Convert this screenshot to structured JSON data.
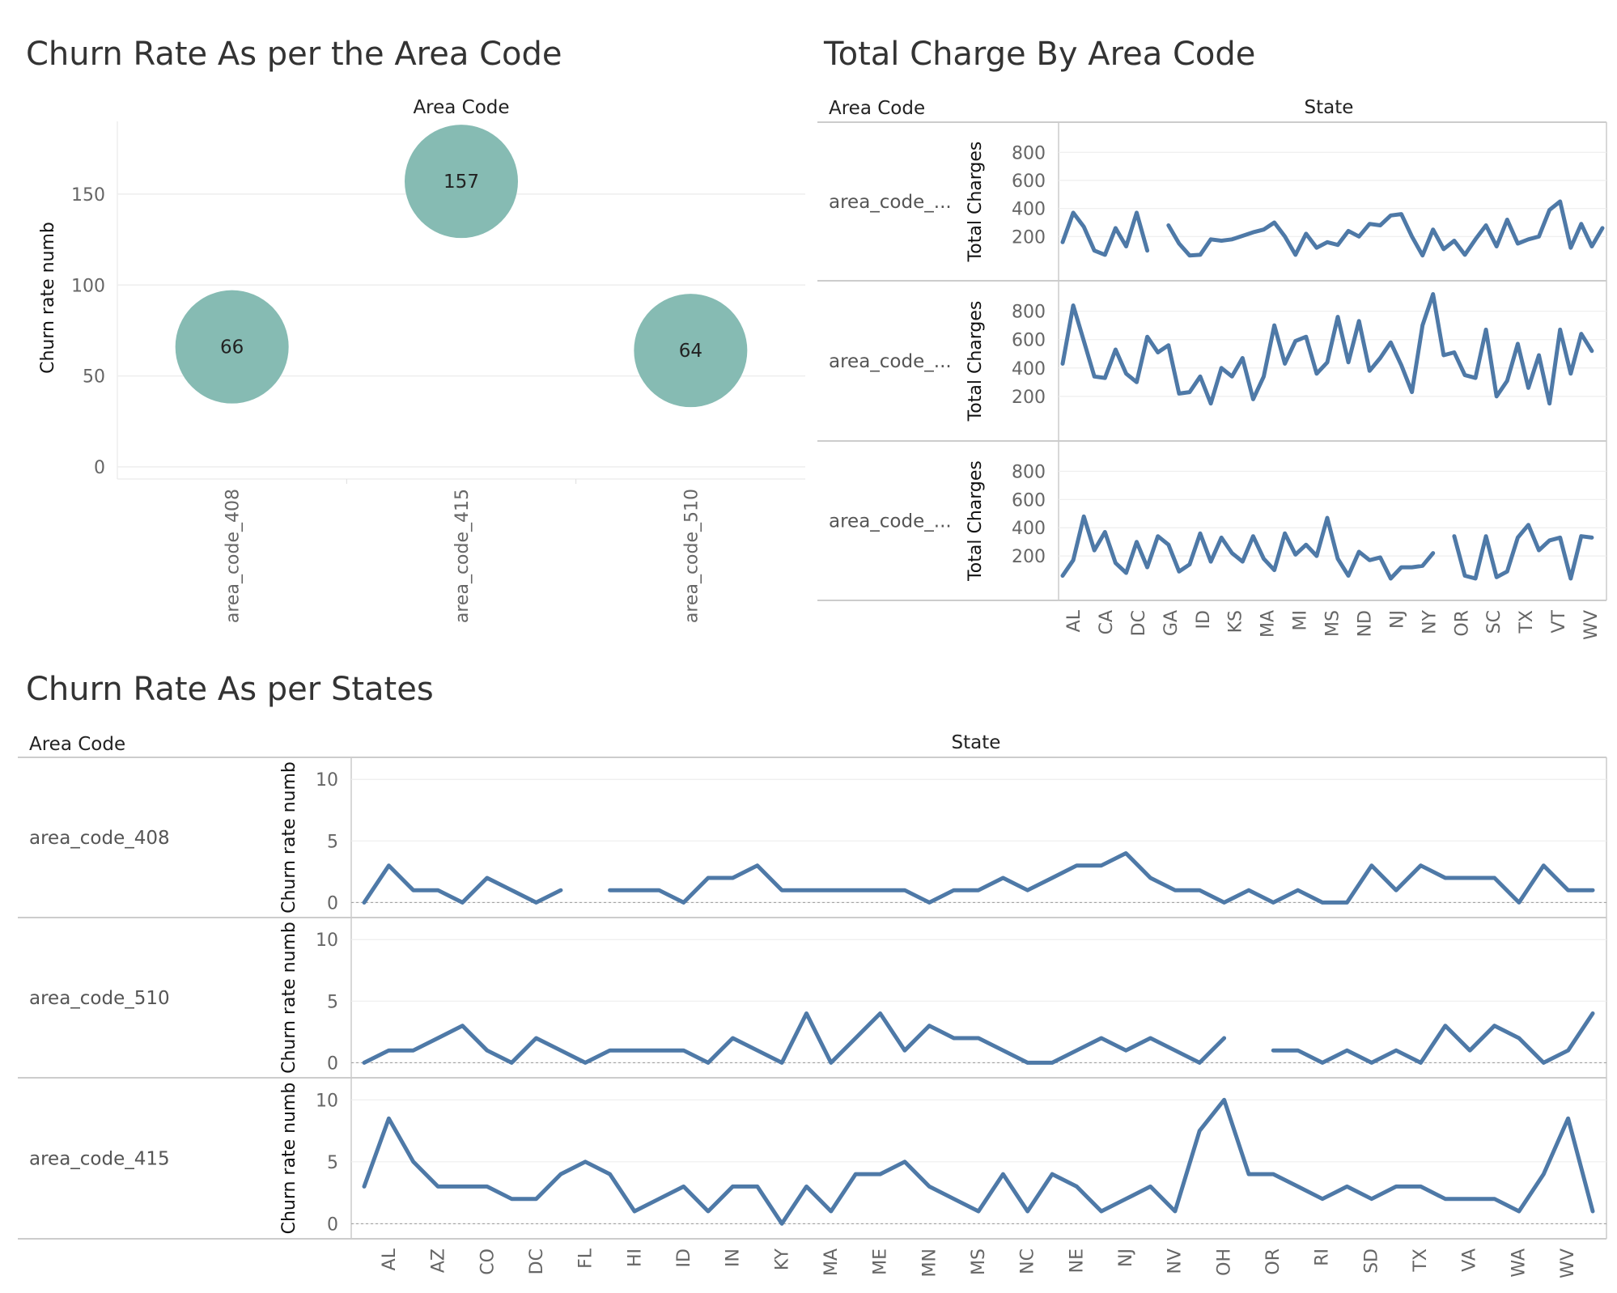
{
  "colors": {
    "line": "#4E79A7",
    "bubble": "#86BBB3",
    "grid": "#eeeeee",
    "border": "#cccccc",
    "text": "#333333"
  },
  "chart_data": [
    {
      "type": "scatter",
      "title": "Churn Rate As per the Area Code",
      "column_header": "Area Code",
      "ylabel": "Churn rate numb",
      "ylim": [
        0,
        190
      ],
      "yticks": [
        0,
        50,
        100,
        150
      ],
      "categories": [
        "area_code_408",
        "area_code_415",
        "area_code_510"
      ],
      "values": [
        66,
        157,
        64
      ]
    },
    {
      "type": "line",
      "title": "Total Charge By Area Code",
      "row_header": "Area Code",
      "column_header": "State",
      "ylabel": "Total Charges",
      "ylim": [
        0,
        900
      ],
      "yticks": [
        200,
        400,
        600,
        800
      ],
      "x_tick_labels": [
        "AL",
        "CA",
        "DC",
        "GA",
        "ID",
        "KS",
        "MA",
        "MI",
        "MS",
        "ND",
        "NJ",
        "NY",
        "OR",
        "SC",
        "TX",
        "VT",
        "WV"
      ],
      "series": [
        {
          "row_label": "area_code_...",
          "values": [
            160,
            370,
            270,
            100,
            70,
            260,
            130,
            370,
            100,
            null,
            280,
            150,
            65,
            70,
            180,
            170,
            180,
            205,
            230,
            250,
            300,
            200,
            70,
            220,
            120,
            160,
            140,
            240,
            200,
            290,
            280,
            350,
            360,
            200,
            65,
            250,
            110,
            170,
            70,
            180,
            280,
            130,
            320,
            150,
            180,
            200,
            390,
            450,
            120,
            290,
            130,
            260
          ]
        },
        {
          "row_label": "area_code_...",
          "values": [
            430,
            840,
            590,
            340,
            330,
            530,
            360,
            300,
            620,
            510,
            560,
            220,
            230,
            340,
            150,
            400,
            340,
            470,
            180,
            340,
            700,
            430,
            590,
            620,
            360,
            440,
            760,
            440,
            730,
            380,
            470,
            580,
            420,
            230,
            700,
            920,
            490,
            510,
            350,
            330,
            670,
            200,
            310,
            570,
            260,
            490,
            150,
            670,
            360,
            640,
            520
          ]
        },
        {
          "row_label": "area_code_...",
          "values": [
            60,
            170,
            480,
            240,
            370,
            150,
            80,
            300,
            120,
            340,
            280,
            90,
            140,
            360,
            160,
            330,
            220,
            160,
            340,
            180,
            100,
            360,
            210,
            280,
            200,
            470,
            180,
            60,
            230,
            170,
            190,
            40,
            120,
            120,
            130,
            220,
            null,
            340,
            60,
            40,
            340,
            50,
            90,
            330,
            420,
            240,
            310,
            330,
            40,
            340,
            330
          ]
        }
      ]
    },
    {
      "type": "line",
      "title": "Churn Rate As per States",
      "row_header": "Area Code",
      "column_header": "State",
      "ylabel": "Churn rate numb",
      "ylim": [
        -0.5,
        11
      ],
      "yticks": [
        0,
        5,
        10
      ],
      "x_tick_labels": [
        "AL",
        "AZ",
        "CO",
        "DC",
        "FL",
        "HI",
        "ID",
        "IN",
        "KY",
        "MA",
        "ME",
        "MN",
        "MS",
        "NC",
        "NE",
        "NJ",
        "NV",
        "OH",
        "OR",
        "RI",
        "SD",
        "TX",
        "VA",
        "WA",
        "WV"
      ],
      "series": [
        {
          "row_label": "area_code_408",
          "values": [
            0,
            3,
            1,
            1,
            0,
            2,
            1,
            0,
            1,
            null,
            1,
            1,
            1,
            0,
            2,
            2,
            3,
            1,
            1,
            1,
            1,
            1,
            1,
            0,
            1,
            1,
            2,
            1,
            2,
            3,
            3,
            4,
            2,
            1,
            1,
            0,
            1,
            0,
            1,
            0,
            0,
            3,
            1,
            3,
            2,
            2,
            2,
            0,
            3,
            1,
            1
          ]
        },
        {
          "row_label": "area_code_510",
          "values": [
            0,
            1,
            1,
            2,
            3,
            1,
            0,
            2,
            1,
            0,
            1,
            1,
            1,
            1,
            0,
            2,
            1,
            0,
            4,
            0,
            2,
            4,
            1,
            3,
            2,
            2,
            1,
            0,
            0,
            1,
            2,
            1,
            2,
            1,
            0,
            2,
            null,
            1,
            1,
            0,
            1,
            0,
            1,
            0,
            3,
            1,
            3,
            2,
            0,
            1,
            4
          ]
        },
        {
          "row_label": "area_code_415",
          "values": [
            3,
            8.5,
            5,
            3,
            3,
            3,
            2,
            2,
            4,
            5,
            4,
            1,
            2,
            3,
            1,
            3,
            3,
            0,
            3,
            1,
            4,
            4,
            5,
            3,
            2,
            1,
            4,
            1,
            4,
            3,
            1,
            2,
            3,
            1,
            7.5,
            10,
            4,
            4,
            3,
            2,
            3,
            2,
            3,
            3,
            2,
            2,
            2,
            1,
            4,
            8.5,
            1
          ]
        }
      ]
    }
  ]
}
